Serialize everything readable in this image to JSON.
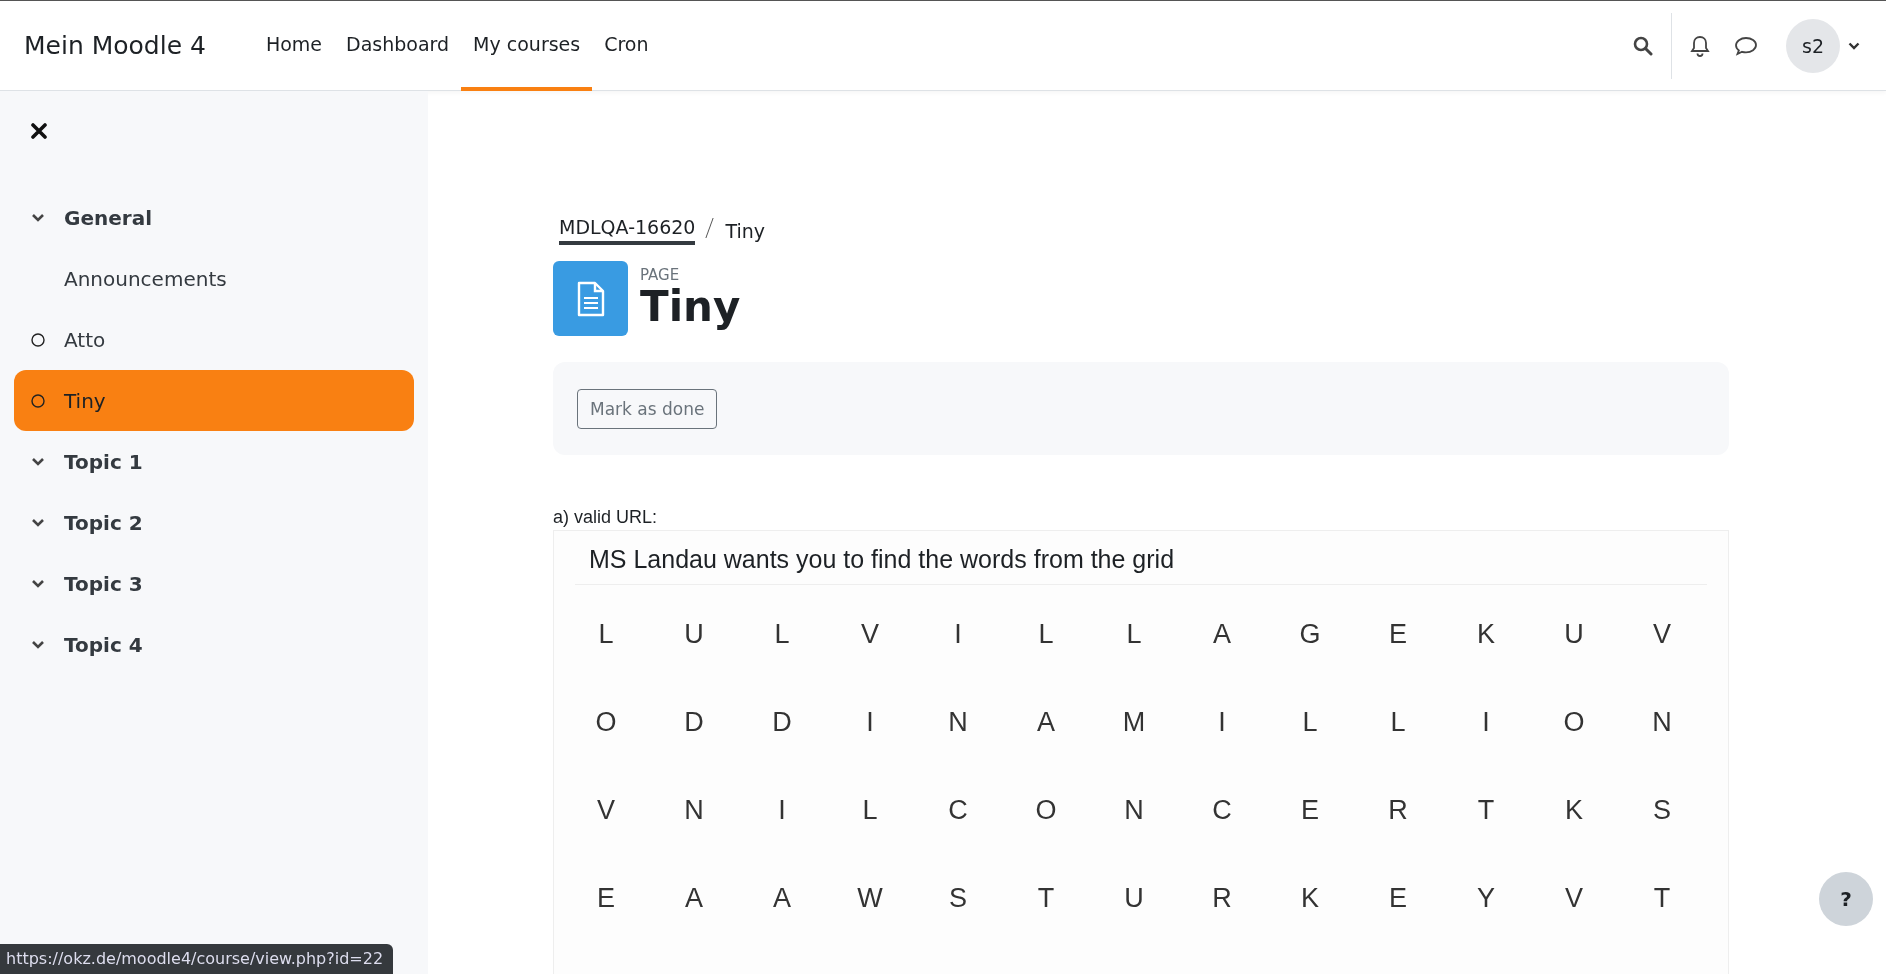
{
  "navbar": {
    "site_name": "Mein Moodle 4",
    "links": [
      {
        "label": "Home",
        "selected": false
      },
      {
        "label": "Dashboard",
        "selected": false
      },
      {
        "label": "My courses",
        "selected": true
      },
      {
        "label": "Cron",
        "selected": false
      }
    ],
    "avatar": "s2"
  },
  "sidebar": {
    "items": [
      {
        "kind": "section",
        "label": "General",
        "expanded": true,
        "children": [
          {
            "kind": "link",
            "label": "Announcements",
            "selected": false
          },
          {
            "kind": "activity",
            "label": "Atto",
            "selected": false
          },
          {
            "kind": "activity",
            "label": "Tiny",
            "selected": true
          }
        ]
      },
      {
        "kind": "section",
        "label": "Topic 1",
        "expanded": true
      },
      {
        "kind": "section",
        "label": "Topic 2",
        "expanded": true
      },
      {
        "kind": "section",
        "label": "Topic 3",
        "expanded": true
      },
      {
        "kind": "section",
        "label": "Topic 4",
        "expanded": true
      }
    ]
  },
  "breadcrumb": [
    "MDLQA-16620",
    "Tiny"
  ],
  "page_header": {
    "type_label": "PAGE",
    "title": "Tiny"
  },
  "completion": {
    "button": "Mark as done"
  },
  "content": {
    "label": "a) valid URL:",
    "embed": {
      "heading": "MS Landau wants you to find the words from the grid",
      "grid": [
        [
          "L",
          "U",
          "L",
          "V",
          "I",
          "L",
          "L",
          "A",
          "G",
          "E",
          "K",
          "U",
          "V"
        ],
        [
          "O",
          "D",
          "D",
          "I",
          "N",
          "A",
          "M",
          "I",
          "L",
          "L",
          "I",
          "O",
          "N"
        ],
        [
          "V",
          "N",
          "I",
          "L",
          "C",
          "O",
          "N",
          "C",
          "E",
          "R",
          "T",
          "K",
          "S"
        ],
        [
          "E",
          "A",
          "A",
          "W",
          "S",
          "T",
          "U",
          "R",
          "K",
          "E",
          "Y",
          "V",
          "T"
        ]
      ]
    }
  },
  "help_button": "?",
  "status_url": "https://okz.de/moodle4/course/view.php?id=22"
}
